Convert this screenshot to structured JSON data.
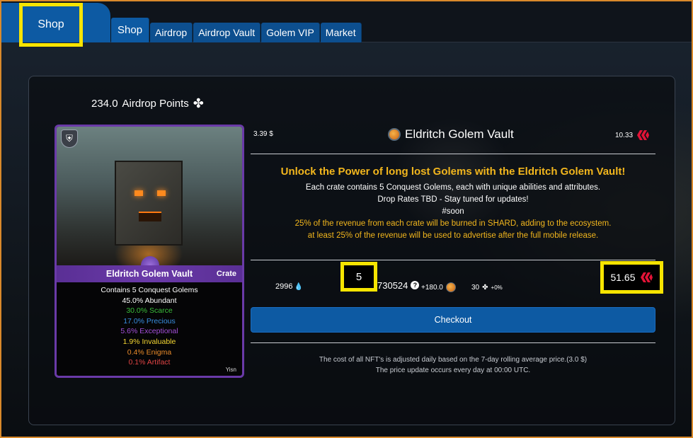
{
  "header": {
    "shop_label": "Shop"
  },
  "tabs": [
    {
      "label": "Shop",
      "active": true
    },
    {
      "label": "Airdrop"
    },
    {
      "label": "Airdrop Vault"
    },
    {
      "label": "Golem VIP"
    },
    {
      "label": "Market"
    }
  ],
  "points": {
    "value": "234.0",
    "label": "Airdrop Points",
    "icon": "clover-icon"
  },
  "card": {
    "title": "Eldritch Golem Vault",
    "type": "Crate",
    "contents": "Contains 5 Conquest Golems",
    "rarities": [
      {
        "text": "45.0% Abundant",
        "color": "#ffffff"
      },
      {
        "text": "30.0% Scarce",
        "color": "#3bbf3b"
      },
      {
        "text": "17.0% Precious",
        "color": "#3a8fe0"
      },
      {
        "text": "5.6% Exceptional",
        "color": "#a34fd9"
      },
      {
        "text": "1.9% Invaluable",
        "color": "#f5d733"
      },
      {
        "text": "0.4% Enigma",
        "color": "#e88a2a"
      },
      {
        "text": "0.1% Artifact",
        "color": "#e04444"
      }
    ],
    "footer": "Yisn"
  },
  "vault": {
    "price_usd": "3.39 $",
    "title": "Eldritch Golem Vault",
    "price_hive": "10.33",
    "headline": "Unlock the Power of long lost Golems with the Eldritch Golem Vault!",
    "lines": [
      "Each crate contains 5 Conquest Golems, each with unique abilities and attributes.",
      "Drop Rates TBD - Stay tuned for updates!",
      "#soon"
    ],
    "orange_lines": [
      "25% of the revenue from each crate will be burned in SHARD, adding to the ecosystem.",
      "at least 25% of the revenue will be used to advertise after the full mobile release."
    ]
  },
  "purchase": {
    "stock": "2996",
    "quantity": "5",
    "supply": "730524",
    "bonus": "+180.0",
    "boost_value": "30",
    "boost_pct": "+0%",
    "total": "51.65",
    "checkout_label": "Checkout"
  },
  "disclaimer": {
    "line1": "The cost of all NFT's is adjusted daily based on the 7-day rolling average price.(3.0 $)",
    "line2": "The price update occurs every day at 00:00 UTC."
  },
  "colors": {
    "brand_blue": "#0d5aa3",
    "highlight_yellow": "#f7e400",
    "headline_orange": "#f2b61d",
    "card_purple": "#6a3aa8",
    "hive_red": "#e31337"
  }
}
